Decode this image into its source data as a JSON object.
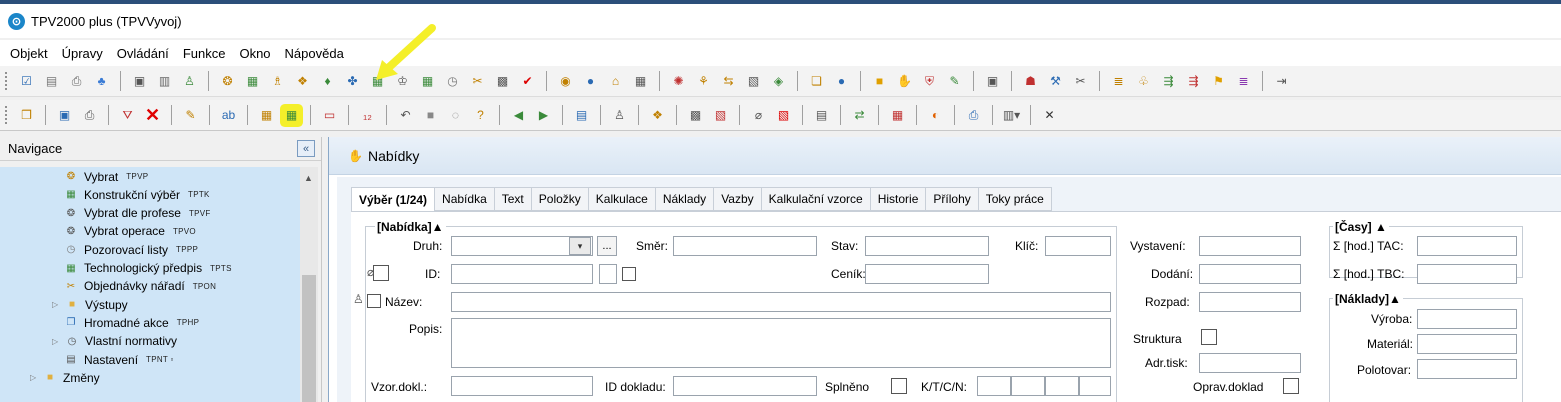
{
  "app": {
    "title": "TPV2000 plus (TPVVyvoj)",
    "icon_glyph": "⊙"
  },
  "menu": [
    "Objekt",
    "Úpravy",
    "Ovládání",
    "Funkce",
    "Okno",
    "Nápověda"
  ],
  "toolbar1": [
    {
      "name": "checklist-icon",
      "glyph": "☑",
      "color": "#2a6ab3"
    },
    {
      "name": "notes-icon",
      "glyph": "▤",
      "color": "#777"
    },
    {
      "name": "print-setup-icon",
      "glyph": "⎙",
      "color": "#666"
    },
    {
      "name": "users-icon",
      "glyph": "♣",
      "color": "#3a7bd5"
    },
    {
      "sep": true
    },
    {
      "name": "document-icon",
      "glyph": "▣",
      "color": "#555"
    },
    {
      "name": "pages-icon",
      "glyph": "▥",
      "color": "#666"
    },
    {
      "name": "tree-icon",
      "glyph": "♙",
      "color": "#3a8a3a"
    },
    {
      "sep": true
    },
    {
      "name": "binoculars-icon",
      "glyph": "❂",
      "color": "#c08000"
    },
    {
      "name": "grid-search-icon",
      "glyph": "▦",
      "color": "#3a8a3a"
    },
    {
      "name": "hierarchy-icon",
      "glyph": "♗",
      "color": "#c08000"
    },
    {
      "name": "package-icon",
      "glyph": "❖",
      "color": "#c08000"
    },
    {
      "name": "chart-icon",
      "glyph": "♦",
      "color": "#3a8a3a"
    },
    {
      "name": "workflow-icon",
      "glyph": "✤",
      "color": "#2a6ab3"
    },
    {
      "name": "table-icon",
      "glyph": "▦",
      "color": "#3a8a3a"
    },
    {
      "name": "scale-icon",
      "glyph": "♔",
      "color": "#555"
    },
    {
      "name": "grid2-icon",
      "glyph": "▦",
      "color": "#3a8a3a"
    },
    {
      "name": "stopwatch-icon",
      "glyph": "◷",
      "color": "#777"
    },
    {
      "name": "tools-icon",
      "glyph": "✂",
      "color": "#c08000"
    },
    {
      "name": "calculator-icon",
      "glyph": "▩",
      "color": "#555"
    },
    {
      "name": "checkmark-icon",
      "glyph": "✔",
      "color": "#d00"
    },
    {
      "sep": true
    },
    {
      "name": "search-object-icon",
      "glyph": "◉",
      "color": "#c08000"
    },
    {
      "name": "person-icon",
      "glyph": "●",
      "color": "#2a6ab3"
    },
    {
      "name": "home-icon",
      "glyph": "⌂",
      "color": "#c08000"
    },
    {
      "name": "calendar-icon",
      "glyph": "▦",
      "color": "#555"
    },
    {
      "sep": true
    },
    {
      "name": "gear-box-icon",
      "glyph": "✺",
      "color": "#c03030"
    },
    {
      "name": "connections-icon",
      "glyph": "⚘",
      "color": "#c08000"
    },
    {
      "name": "flow-icon",
      "glyph": "⇆",
      "color": "#c08000"
    },
    {
      "name": "export-icon",
      "glyph": "▧",
      "color": "#555"
    },
    {
      "name": "diamond-arrow-icon",
      "glyph": "◈",
      "color": "#3a8a3a"
    },
    {
      "sep": true
    },
    {
      "name": "folder-open-icon",
      "glyph": "❏",
      "color": "#c08000"
    },
    {
      "name": "user-blue-icon",
      "glyph": "●",
      "color": "#2a6ab3"
    },
    {
      "sep": true
    },
    {
      "name": "cube-icon",
      "glyph": "■",
      "color": "#e0a000"
    },
    {
      "name": "hand-icon",
      "glyph": "✋",
      "color": "#c08000"
    },
    {
      "name": "shield-icon",
      "glyph": "⛨",
      "color": "#c03030"
    },
    {
      "name": "edit-green-icon",
      "glyph": "✎",
      "color": "#3a8a3a"
    },
    {
      "sep": true
    },
    {
      "name": "image-icon",
      "glyph": "▣",
      "color": "#555"
    },
    {
      "sep": true
    },
    {
      "name": "hierarchy-red-icon",
      "glyph": "☗",
      "color": "#c03030"
    },
    {
      "name": "tools2-icon",
      "glyph": "⚒",
      "color": "#2a6ab3"
    },
    {
      "name": "pliers-icon",
      "glyph": "✂",
      "color": "#555"
    },
    {
      "sep": true
    },
    {
      "name": "list-icon",
      "glyph": "≣",
      "color": "#c08000"
    },
    {
      "name": "tree-plus-icon",
      "glyph": "♧",
      "color": "#c08000"
    },
    {
      "name": "list-arrow-icon",
      "glyph": "⇶",
      "color": "#3a8a3a"
    },
    {
      "name": "list-red-icon",
      "glyph": "⇶",
      "color": "#c03030"
    },
    {
      "name": "flag-icon",
      "glyph": "⚑",
      "color": "#e0a000"
    },
    {
      "name": "list-purple-icon",
      "glyph": "≣",
      "color": "#8a3ab0"
    },
    {
      "sep": true
    },
    {
      "name": "exit-icon",
      "glyph": "⇥",
      "color": "#555"
    }
  ],
  "toolbar2": [
    {
      "name": "box-icon",
      "glyph": "❒",
      "color": "#c08000"
    },
    {
      "sep": true
    },
    {
      "name": "save-icon",
      "glyph": "▣",
      "color": "#2a6ab3"
    },
    {
      "name": "print-icon",
      "glyph": "⎙",
      "color": "#555"
    },
    {
      "sep": true
    },
    {
      "name": "filter-check-icon",
      "glyph": "⛛",
      "color": "#c03030"
    },
    {
      "name": "delete-icon",
      "glyph": "✕",
      "color": "#e00000",
      "big": true
    },
    {
      "sep": true
    },
    {
      "name": "pencil-icon",
      "glyph": "✎",
      "color": "#c08000"
    },
    {
      "sep": true
    },
    {
      "name": "text-replace-icon",
      "glyph": "ab",
      "color": "#2a6ab3"
    },
    {
      "sep": true
    },
    {
      "name": "grid-yellow-icon",
      "glyph": "▦",
      "color": "#c08000"
    },
    {
      "name": "grid-highlighted-icon",
      "glyph": "▦",
      "color": "#3a8a3a",
      "hl": true
    },
    {
      "sep": true
    },
    {
      "name": "remove-row-icon",
      "glyph": "▭",
      "color": "#c03030"
    },
    {
      "sep": true
    },
    {
      "name": "number-icon",
      "glyph": "₁₂",
      "color": "#c03030"
    },
    {
      "sep": true
    },
    {
      "name": "undo-icon",
      "glyph": "↶",
      "color": "#555"
    },
    {
      "name": "stop-icon",
      "glyph": "■",
      "color": "#888"
    },
    {
      "name": "comment-icon",
      "glyph": "◌",
      "color": "#777"
    },
    {
      "name": "help-icon",
      "glyph": "?",
      "color": "#c08000"
    },
    {
      "sep": true
    },
    {
      "name": "prev-icon",
      "glyph": "◀",
      "color": "#3a8a3a"
    },
    {
      "name": "next-icon",
      "glyph": "▶",
      "color": "#3a8a3a"
    },
    {
      "sep": true
    },
    {
      "name": "window-icon",
      "glyph": "▤",
      "color": "#2a6ab3"
    },
    {
      "sep": true
    },
    {
      "name": "network-icon",
      "glyph": "♙",
      "color": "#555"
    },
    {
      "sep": true
    },
    {
      "name": "package2-icon",
      "glyph": "❖",
      "color": "#c08000"
    },
    {
      "sep": true
    },
    {
      "name": "calc-icon",
      "glyph": "▩",
      "color": "#555"
    },
    {
      "name": "pdf-edit-icon",
      "glyph": "▧",
      "color": "#c03030"
    },
    {
      "sep": true
    },
    {
      "name": "paperclip-icon",
      "glyph": "⌀",
      "color": "#555"
    },
    {
      "name": "pdf-icon",
      "glyph": "▧",
      "color": "#d00"
    },
    {
      "sep": true
    },
    {
      "name": "table2-icon",
      "glyph": "▤",
      "color": "#555"
    },
    {
      "sep": true
    },
    {
      "name": "transfer-icon",
      "glyph": "⇄",
      "color": "#3a8a3a"
    },
    {
      "sep": true
    },
    {
      "name": "grid-red-icon",
      "glyph": "▦",
      "color": "#c03030"
    },
    {
      "sep": true
    },
    {
      "name": "color-tool-icon",
      "glyph": "◐",
      "color": "#e06000"
    },
    {
      "sep": true
    },
    {
      "name": "printer2-icon",
      "glyph": "⎙",
      "color": "#2a6ab3"
    },
    {
      "sep": true
    },
    {
      "name": "columns-icon",
      "glyph": "▥▾",
      "color": "#555"
    },
    {
      "sep": true
    },
    {
      "name": "close-icon",
      "glyph": "✕",
      "color": "#333"
    }
  ],
  "nav": {
    "title": "Navigace",
    "collapse_glyph": "«",
    "items": [
      {
        "label": "Vybrat",
        "code": "TPVP",
        "icon": "binoculars-icon",
        "glyph": "❂",
        "color": "#c08000",
        "indent": 2
      },
      {
        "label": "Konstrukční výběr",
        "code": "TPTK",
        "icon": "grid-search-icon",
        "glyph": "▦",
        "color": "#3a8a3a",
        "indent": 2
      },
      {
        "label": "Vybrat dle profese",
        "code": "TPVF",
        "icon": "binoculars-person-icon",
        "glyph": "❂",
        "color": "#555",
        "indent": 2
      },
      {
        "label": "Vybrat operace",
        "code": "TPVO",
        "icon": "binoculars-op-icon",
        "glyph": "❂",
        "color": "#555",
        "indent": 2
      },
      {
        "label": "Pozorovací listy",
        "code": "TPPP",
        "icon": "stopwatch-icon",
        "glyph": "◷",
        "color": "#777",
        "indent": 2
      },
      {
        "label": "Technologický předpis",
        "code": "TPTS",
        "icon": "table-icon",
        "glyph": "▦",
        "color": "#3a8a3a",
        "indent": 2
      },
      {
        "label": "Objednávky nářadí",
        "code": "TPON",
        "icon": "tools-icon",
        "glyph": "✂",
        "color": "#c08000",
        "indent": 2
      },
      {
        "label": "Výstupy",
        "code": "",
        "icon": "folder-icon",
        "glyph": "■",
        "color": "#e0b040",
        "indent": 1,
        "expander": "▷"
      },
      {
        "label": "Hromadné akce",
        "code": "TPHP",
        "icon": "copy-icon",
        "glyph": "❐",
        "color": "#2a6ab3",
        "indent": 2
      },
      {
        "label": "Vlastní normativy",
        "code": "",
        "icon": "clock-icon",
        "glyph": "◷",
        "color": "#555",
        "indent": 1,
        "expander": "▷"
      },
      {
        "label": "Nastavení",
        "code": "TPNT ▫",
        "icon": "settings-doc-icon",
        "glyph": "▤",
        "color": "#555",
        "indent": 2
      },
      {
        "label": "Změny",
        "code": "",
        "icon": "changes-folder-icon",
        "glyph": "■",
        "color": "#e0b040",
        "indent": 0,
        "expander": "▷"
      }
    ]
  },
  "main": {
    "title": "Nabídky",
    "tabs": [
      "Výběr (1/24)",
      "Nabídka",
      "Text",
      "Položky",
      "Kalkulace",
      "Náklady",
      "Vazby",
      "Kalkulační vzorce",
      "Historie",
      "Přílohy",
      "Toky práce"
    ],
    "form": {
      "section_offer": "[Nabídka]▲",
      "druh": "Druh:",
      "druh_value": "",
      "smer": "Směr:",
      "stav": "Stav:",
      "klic": "Klíč:",
      "id": "ID:",
      "cenik": "Ceník:",
      "nazev": "Název:",
      "popis": "Popis:",
      "vzor_dokl": "Vzor.dokl.:",
      "id_dokladu": "ID dokladu:",
      "splneno": "Splněno",
      "ktcn": "K/T/C/N:",
      "vystaveni": "Vystavení:",
      "dodani": "Dodání:",
      "rozpad": "Rozpad:",
      "struktura": "Struktura",
      "adr_tisk": "Adr.tisk:",
      "oprav_doklad": "Oprav.doklad",
      "ellipsis": "...",
      "section_times": "[Časy] ▲",
      "tac": "Σ [hod.] TAC:",
      "tbc": "Σ [hod.] TBC:",
      "section_costs": "[Náklady]▲",
      "vyroba": "Výroba:",
      "material": "Materiál:",
      "polotovar": "Polotovar:"
    }
  },
  "colors": {
    "nav_selected_bg": "#cfe5f7",
    "highlight": "#f4ef2a",
    "header_gradient_top": "#eaf1f9"
  }
}
